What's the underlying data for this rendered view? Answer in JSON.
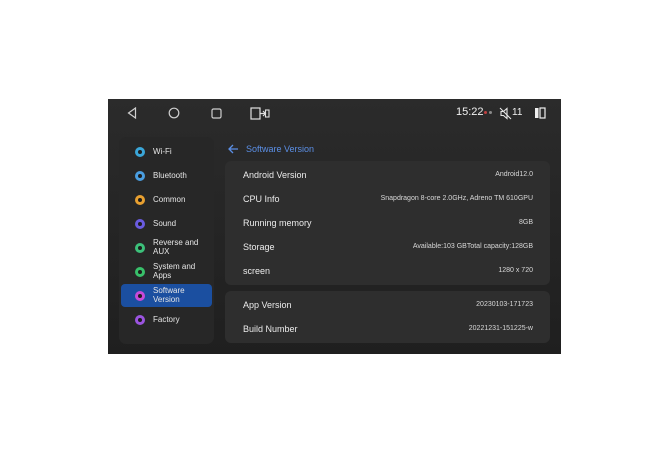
{
  "statusbar": {
    "time": "15:22",
    "volume_level": "11",
    "icons": [
      "back-icon",
      "home-icon",
      "recents-icon",
      "split-screen-icon",
      "mute-icon",
      "side-panel-icon"
    ]
  },
  "sidebar": {
    "items": [
      {
        "label": "Wi-Fi",
        "icon": "wifi-icon",
        "color": "#3aa6d8",
        "active": false
      },
      {
        "label": "Bluetooth",
        "icon": "bluetooth-icon",
        "color": "#4a9ee0",
        "active": false
      },
      {
        "label": "Common",
        "icon": "common-icon",
        "color": "#e8a030",
        "active": false
      },
      {
        "label": "Sound",
        "icon": "sound-icon",
        "color": "#6a5ce0",
        "active": false
      },
      {
        "label": "Reverse and\nAUX",
        "icon": "reverse-icon",
        "color": "#3cc07a",
        "active": false
      },
      {
        "label": "System and\nApps",
        "icon": "system-icon",
        "color": "#38c06a",
        "active": false
      },
      {
        "label": "Software\nVersion",
        "icon": "software-icon",
        "color": "#c84ad8",
        "active": true
      },
      {
        "label": "Factory",
        "icon": "factory-icon",
        "color": "#9b54e0",
        "active": false
      }
    ]
  },
  "header": {
    "back_icon": "arrow-left-icon",
    "title": "Software Version"
  },
  "card1": {
    "rows": [
      {
        "label": "Android Version",
        "value": "Android12.0"
      },
      {
        "label": "CPU Info",
        "value": "Snapdragon 8-core 2.0GHz, Adreno TM 610GPU"
      },
      {
        "label": "Running memory",
        "value": "8GB"
      },
      {
        "label": "Storage",
        "value": "Available:103 GBTotal capacity:128GB"
      },
      {
        "label": "screen",
        "value": "1280 x 720"
      }
    ]
  },
  "card2": {
    "rows": [
      {
        "label": "App Version",
        "value": "20230103-171723"
      },
      {
        "label": "Build Number",
        "value": "20221231-151225-w"
      }
    ]
  },
  "colors": {
    "accent": "#5b8fe6",
    "active_item": "#1b4fa0",
    "background": "#232323",
    "card": "#2e2e2e"
  }
}
